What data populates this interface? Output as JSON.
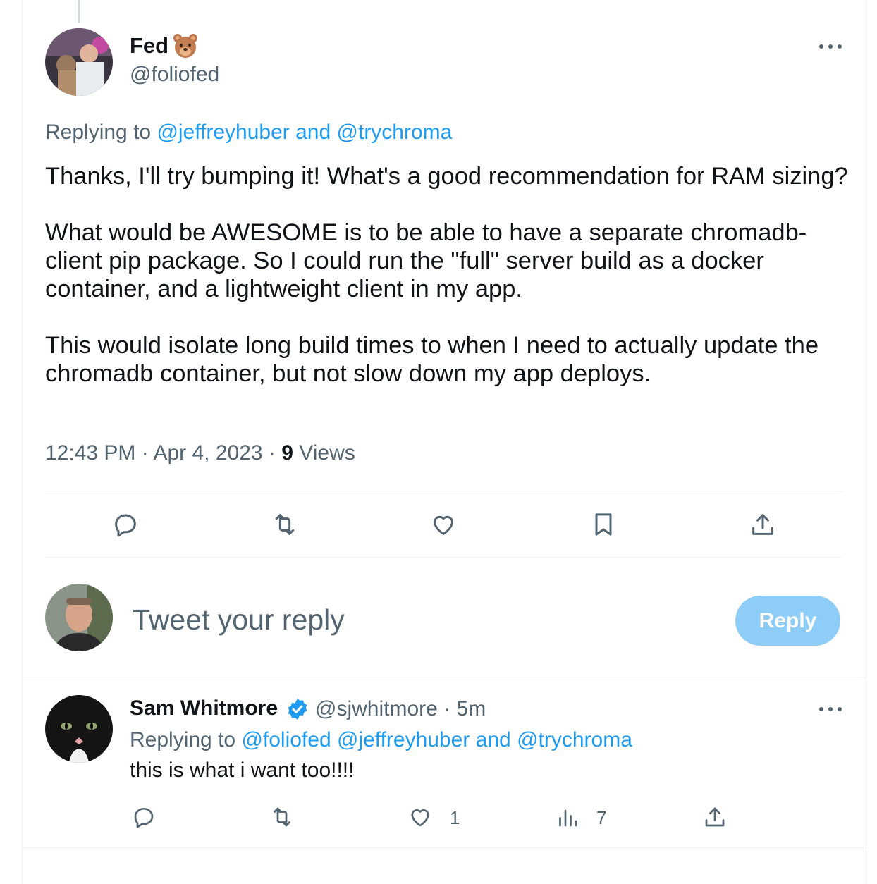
{
  "main_tweet": {
    "author_name": "Fed",
    "author_emoji": "bear-face-emoji",
    "author_handle": "@foliofed",
    "replying_prefix": "Replying to",
    "replying_to_1": "@jeffreyhuber",
    "replying_and": "and",
    "replying_to_2": "@trychroma",
    "paragraphs": [
      "Thanks, I'll try bumping it! What's a good recommendation for RAM sizing?",
      "What would be AWESOME is to be able to have a separate chromadb-client pip package. So I could run the \"full\" server build as a docker container, and a lightweight client in my app.",
      "This would isolate long build times to when I need to actually update the chromadb container, but not slow down my app deploys."
    ],
    "time": "12:43 PM",
    "separator": "·",
    "date": "Apr 4, 2023",
    "views_count": "9",
    "views_label": "Views",
    "actions": [
      "reply-icon",
      "retweet-icon",
      "like-icon",
      "bookmark-icon",
      "share-icon"
    ]
  },
  "composer": {
    "placeholder": "Tweet your reply",
    "button_label": "Reply"
  },
  "reply_tweet": {
    "author_name": "Sam Whitmore",
    "verified": true,
    "author_handle": "@sjwhitmore",
    "separator": "·",
    "time_ago": "5m",
    "replying_prefix": "Replying to",
    "replying_to_1": "@foliofed",
    "replying_to_2": "@jeffreyhuber",
    "replying_and": "and",
    "replying_to_3": "@trychroma",
    "text": "this is what i want too!!!!",
    "like_count": "1",
    "views_count": "7"
  },
  "colors": {
    "accent": "#1d9bf0",
    "secondary_text": "#536471",
    "reply_button_disabled": "#8ecdf8",
    "divider": "#eff3f4"
  }
}
